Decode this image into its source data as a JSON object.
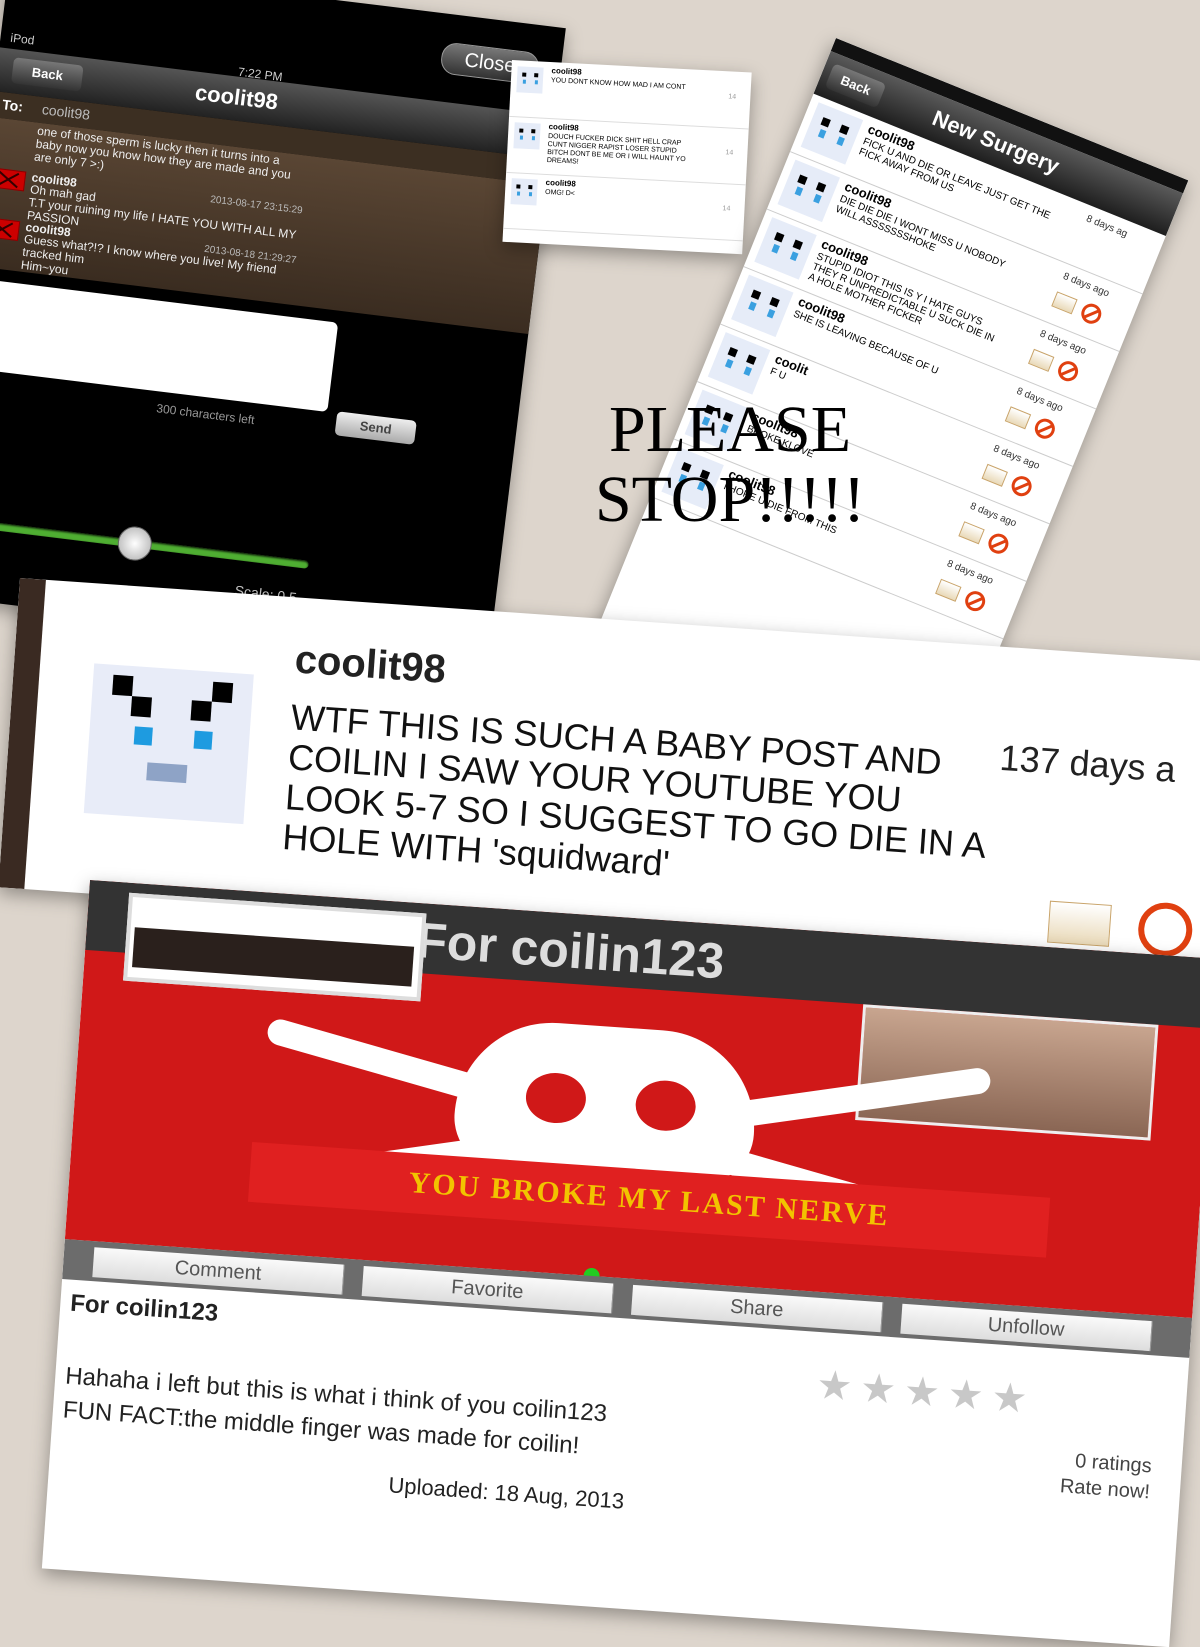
{
  "chat": {
    "close_label": "Close",
    "carrier": "iPod",
    "time": "7:22 PM",
    "back_label": "Back",
    "title": "coolit98",
    "to_label": "To:",
    "to_value": "coolit98",
    "messages": [
      {
        "user": "",
        "stamp": "",
        "body": "one of those sperm is lucky then it turns into a\nbaby now you know how they are made and you\nare only 7 >:)"
      },
      {
        "user": "coolit98",
        "stamp": "2013-08-17 23:15:29",
        "body": "Oh mah gad\nT.T your ruining my life I HATE YOU WITH ALL MY\nPASSION"
      },
      {
        "user": "coolit98",
        "stamp": "2013-08-18 21:29:27",
        "body": "Guess what?!? I know where you live! My friend\ntracked him\nHim~you"
      }
    ],
    "counter": "300 characters left",
    "send_label": "Send",
    "scale": "Scale: 0.5",
    "scale_value": 0.5
  },
  "mini": {
    "rows": [
      {
        "user": "coolit98",
        "text": "YOU DONT KNOW HOW MAD I AM CONT",
        "num": "14"
      },
      {
        "user": "coolit98",
        "text": "DOUCH FUCKER DICK SHIT HELL CRAP\nCUNT NIGGER RAPIST LOSER STUPID\nBITCH DONT BE ME OR I WILL HAUNT YO\nDREAMS!",
        "num": "14"
      },
      {
        "user": "coolit98",
        "text": "OMG! D<",
        "num": "14"
      }
    ]
  },
  "surgery": {
    "back_label": "Back",
    "title": "New Surgery",
    "items": [
      {
        "user": "coolit98",
        "text": "FICK U AND DIE OR LEAVE JUST GET THE\nFICK AWAY FROM US",
        "ago": "8 days ag"
      },
      {
        "user": "coolit98",
        "text": "DIE DIE DIE I WONT MISS U NOBODY\nWILL ASSSSSSSHOKE",
        "ago": "8 days ago"
      },
      {
        "user": "coolit98",
        "text": "STUPID IDIOT THIS IS Y I HATE GUYS\nTHEY R UNPREDICTABLE U SUCK DIE IN\nA HOLE MOTHER FICKER",
        "ago": "8 days ago"
      },
      {
        "user": "coolit98",
        "text": "SHE IS LEAVING BECAUSE OF U",
        "ago": "8 days ago"
      },
      {
        "user": "coolit",
        "text": "F U",
        "ago": "8 days ago"
      },
      {
        "user": "coolit98",
        "text": "BROKE KLOVE",
        "ago": "8 days ago"
      },
      {
        "user": "coolit98",
        "text": "I HOPE U DIE FROM THIS",
        "ago": "8 days ago"
      }
    ]
  },
  "please": {
    "line1": "PLEASE",
    "line2": "STOP!!!!!"
  },
  "comment": {
    "user": "coolit98",
    "text": "WTF THIS IS SUCH A BABY POST AND\nCOILIN I SAW YOUR YOUTUBE YOU\nLOOK 5-7 SO I SUGGEST TO GO DIE IN A\nHOLE WITH 'squidward'",
    "days": "137 days a"
  },
  "post": {
    "header": "For coilin123",
    "banner": "YOU BROKE MY LAST NERVE",
    "tabs": [
      "Comment",
      "Favorite",
      "Share",
      "Unfollow"
    ],
    "for_label": "For coilin123",
    "description": "Hahaha i left but this is what i think of you coilin123\nFUN FACT:the middle finger was made for coilin!",
    "stars": "★★★★★",
    "rating_value": 0,
    "ratings": "0 ratings",
    "rate_now": "Rate now!",
    "uploaded": "Uploaded: 18 Aug, 2013"
  }
}
